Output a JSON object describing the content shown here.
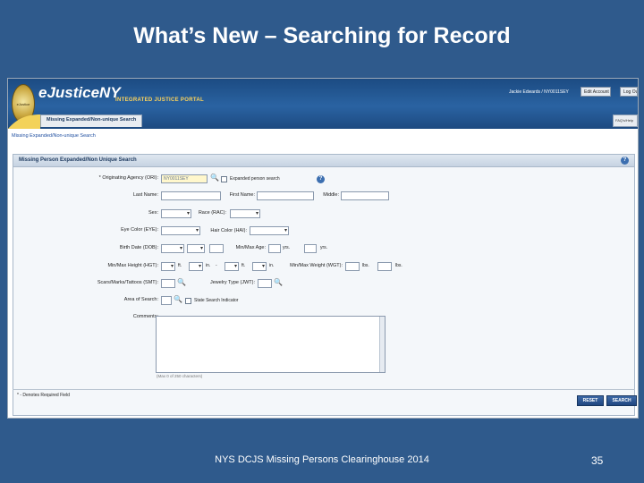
{
  "slide": {
    "title": "What’s New – Searching for Record",
    "footer": "NYS DCJS Missing Persons Clearinghouse 2014",
    "page_number": "35"
  },
  "app": {
    "brand": "eJusticeNY",
    "portal": "INTEGRATED JUSTICE PORTAL",
    "seal_text": "eJustice",
    "user": "Jackie Edwards / NY0011SEY",
    "edit_account": "Edit Account",
    "log_out": "Log Out",
    "tab": "Missing Expanded/Non-unique Search",
    "side_tab": "FAQ's/Help",
    "breadcrumb": "Missing Expanded/Non-unique Search"
  },
  "form": {
    "title": "Missing Person Expanded/Non Unique Search",
    "help": "?",
    "labels": {
      "ori": "* Originating Agency (ORI):",
      "expanded": "Expanded person search",
      "last": "Last Name:",
      "first": "First Name:",
      "middle": "Middle:",
      "sex": "Sex:",
      "race": "Race (RAC):",
      "eye": "Eye Color (EYE):",
      "hair": "Hair Color (HAI):",
      "dob": "Birth Date (DOB):",
      "age": "Min/Max Age:",
      "yrs1": "yrs.",
      "yrs2": "yrs.",
      "height": "Min/Max Height (HGT):",
      "ft1": "ft.",
      "in1": "in.",
      "dash": "-",
      "ft2": "ft.",
      "in2": "in.",
      "weight": "Min/Max Weight (WGT):",
      "lbs1": "lbs.",
      "lbs2": "lbs.",
      "smt": "Scars/Marks/Tattoos (SMT):",
      "jewelry": "Jewelry Type (JWT):",
      "area": "Area of Search:",
      "state": "State Search Indicator",
      "comments": "Comments:"
    },
    "values": {
      "ori": "NY0011SEY"
    },
    "char_count": "(Max 0 of 250 characters)",
    "required_note": "* - Denotes Required Field",
    "reset": "RESET",
    "search": "SEARCH"
  }
}
